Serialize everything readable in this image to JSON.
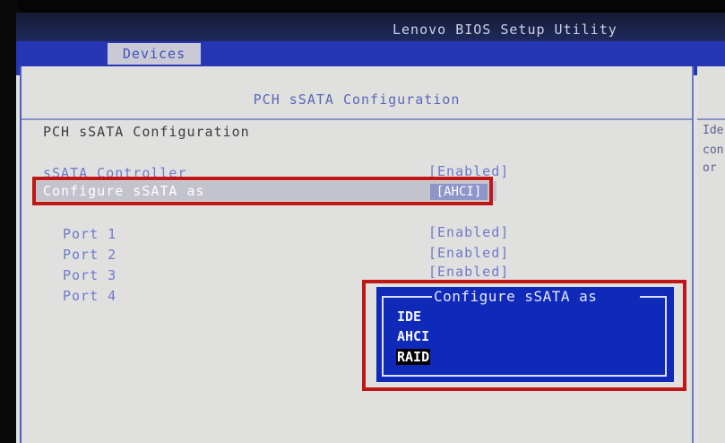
{
  "window": {
    "title": "Lenovo BIOS Setup Utility"
  },
  "tabs": [
    {
      "label": "Devices"
    }
  ],
  "main": {
    "title": "PCH sSATA Configuration",
    "section_heading": "PCH sSATA Configuration",
    "settings": [
      {
        "label": "sSATA Controller",
        "value": "[Enabled]"
      },
      {
        "label": "Configure sSATA as",
        "value": "[AHCI]"
      }
    ],
    "ports": [
      {
        "label": "Port 1",
        "value": "[Enabled]"
      },
      {
        "label": "Port 2",
        "value": "[Enabled]"
      },
      {
        "label": "Port 3",
        "value": "[Enabled]"
      },
      {
        "label": "Port 4",
        "value": ""
      }
    ]
  },
  "help": {
    "lines": [
      "Ide",
      "con",
      "or"
    ]
  },
  "popup": {
    "title": "Configure sSATA as",
    "options": [
      "IDE",
      "AHCI",
      "RAID"
    ],
    "selected_index": 2
  },
  "colors": {
    "highlight": "#c01616",
    "popup_bg": "#0f2ab8",
    "tab_strip": "#2736b4",
    "text_blue": "#6e79c9"
  }
}
